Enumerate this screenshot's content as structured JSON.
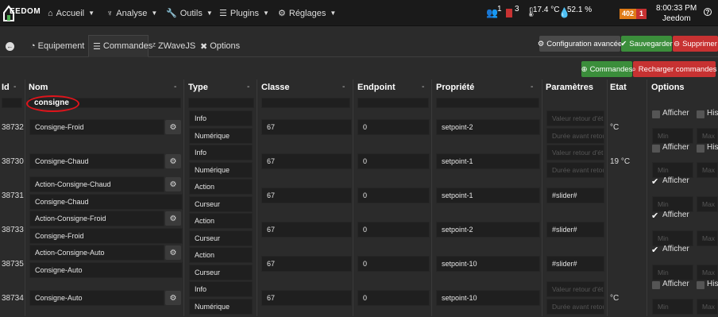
{
  "app": {
    "brand": "EEDOM",
    "time": "8:00:33 PM",
    "user": "Jeedom"
  },
  "nav": {
    "accueil": "Accueil",
    "analyse": "Analyse",
    "outils": "Outils",
    "plugins": "Plugins",
    "reglages": "Réglages"
  },
  "status": {
    "persons": "1",
    "door": "3",
    "temp": "17.4 °C",
    "humidity": "52.1 %",
    "badge_orange": "402",
    "badge_red": "1"
  },
  "tabs": {
    "equipement": "Equipement",
    "commandes": "Commandes",
    "zwavejs": "ZWaveJS",
    "options": "Options"
  },
  "actions": {
    "config": "Configuration avancée",
    "save": "Sauvegarder",
    "delete": "Supprimer",
    "add_commands": "Commandes",
    "reload": "Recharger commandes"
  },
  "columns": {
    "id": "Id",
    "nom": "Nom",
    "type": "Type",
    "classe": "Classe",
    "endpoint": "Endpoint",
    "propriete": "Propriété",
    "parametres": "Paramètres",
    "etat": "Etat",
    "options": "Options"
  },
  "filter": {
    "nom": "consigne"
  },
  "placeholders": {
    "valeur_retour": "Valeur retour d'ét",
    "duree": "Durée avant retou",
    "min": "Min",
    "max": "Max"
  },
  "options": {
    "afficher": "Afficher",
    "historiser": "His"
  },
  "rows": [
    {
      "id": "38732",
      "name": "Consigne-Froid",
      "type": "Info",
      "subtype": "Numérique",
      "classe": "67",
      "endpoint": "0",
      "propriete": "setpoint-2",
      "etat": "°C"
    },
    {
      "id": "38730",
      "name": "Consigne-Chaud",
      "type": "Info",
      "subtype": "Numérique",
      "classe": "67",
      "endpoint": "0",
      "propriete": "setpoint-1",
      "etat": "19 °C"
    },
    {
      "id": "38731",
      "name": "Action-Consigne-Chaud",
      "value": "Consigne-Chaud",
      "type": "Action",
      "subtype": "Curseur",
      "classe": "67",
      "endpoint": "0",
      "propriete": "setpoint-1",
      "param": "#slider#"
    },
    {
      "id": "38733",
      "name": "Action-Consigne-Froid",
      "value": "Consigne-Froid",
      "type": "Action",
      "subtype": "Curseur",
      "classe": "67",
      "endpoint": "0",
      "propriete": "setpoint-2",
      "param": "#slider#"
    },
    {
      "id": "38735",
      "name": "Action-Consigne-Auto",
      "value": "Consigne-Auto",
      "type": "Action",
      "subtype": "Curseur",
      "classe": "67",
      "endpoint": "0",
      "propriete": "setpoint-10",
      "param": "#slider#"
    },
    {
      "id": "38734",
      "name": "Consigne-Auto",
      "type": "Info",
      "subtype": "Numérique",
      "classe": "67",
      "endpoint": "0",
      "propriete": "setpoint-10",
      "etat": "°C"
    }
  ],
  "colors": {
    "green": "#3b8e3b",
    "red": "#c73232",
    "orange": "#e07b17",
    "dark": "#4a4a4a"
  }
}
